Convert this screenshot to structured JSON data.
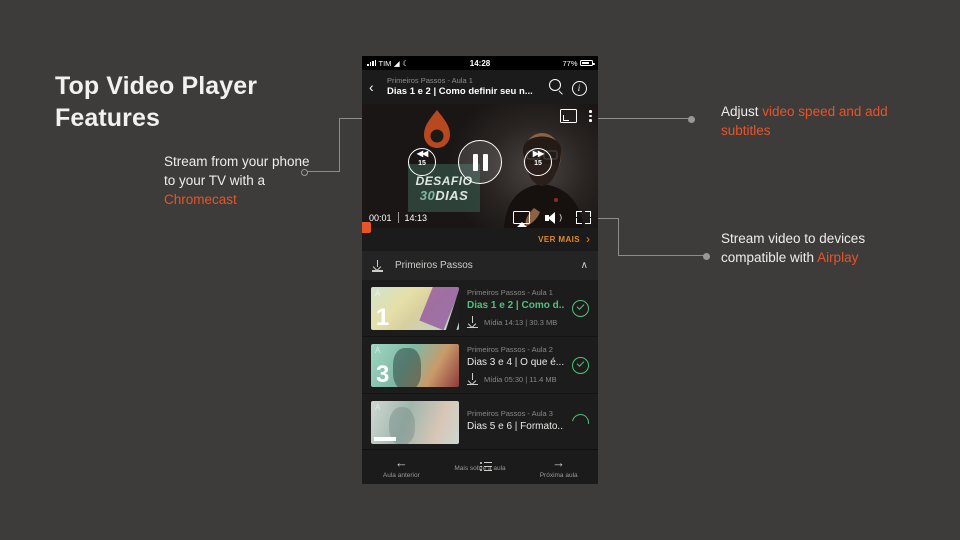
{
  "slide": {
    "title_line1": "Top Video Player",
    "title_line2": "Features",
    "background_color": "#3d3c3a",
    "accent_color": "#e8542a"
  },
  "callouts": {
    "chromecast": {
      "lead": "Stream from your phone to your TV with a ",
      "highlight": "Chromecast"
    },
    "speed": {
      "lead": "Adjust ",
      "highlight": "video speed and add subtitles"
    },
    "airplay": {
      "lead": "Stream video to devices compatible with ",
      "highlight": "Airplay"
    }
  },
  "phone": {
    "status_bar": {
      "carrier": "TIM",
      "time": "14:28",
      "battery_percent": "77%"
    },
    "app_header": {
      "back_icon": "chevron-left-icon",
      "subtitle": "Primeiros Passos - Aula 1",
      "title": "Dias 1 e 2 | Como definir seu n...",
      "search_icon": "search-icon",
      "info_icon": "info-icon"
    },
    "video_player": {
      "cast_icon": "chromecast-icon",
      "more_icon": "kebab-menu-icon",
      "rewind_label": "15",
      "forward_label": "15",
      "play_state_icon": "pause-icon",
      "current_time": "00:01",
      "duration": "14:13",
      "airplay_icon": "airplay-icon",
      "volume_icon": "volume-icon",
      "fullscreen_icon": "fullscreen-icon",
      "overlay_brand_line1": "DESAFIO",
      "overlay_brand_num": "30",
      "overlay_brand_line2": "DIAS"
    },
    "ver_mais": {
      "label": "VER MAIS",
      "chevron": "›"
    },
    "section": {
      "download_icon": "download-icon",
      "name": "Primeiros Passos",
      "collapse_chevron": "∧"
    },
    "lessons": [
      {
        "thumb_label": "1",
        "thumb_tag": "A",
        "supertitle": "Primeiros Passos - Aula 1",
        "title": "Dias 1 e 2 | Como d...",
        "active": true,
        "media_info": "Mídia 14:13 | 30.3 MB",
        "status_icon": "check-circle-icon"
      },
      {
        "thumb_label": "3",
        "thumb_tag": "A",
        "supertitle": "Primeiros Passos - Aula 2",
        "title": "Dias 3 e 4 | O que é...",
        "active": false,
        "media_info": "Mídia 05:30 | 11.4 MB",
        "status_icon": "check-circle-icon"
      },
      {
        "thumb_label": "",
        "thumb_tag": "A",
        "supertitle": "Primeiros Passos - Aula 3",
        "title": "Dias 5 e 6 | Formato...",
        "active": false,
        "media_info": "",
        "status_icon": "progress-circle-icon"
      }
    ],
    "bottom_nav": [
      {
        "icon": "arrow-left-icon",
        "glyph": "←",
        "label": "Aula anterior"
      },
      {
        "icon": "list-icon",
        "glyph": "",
        "label": "Mais sobre a aula"
      },
      {
        "icon": "arrow-right-icon",
        "glyph": "→",
        "label": "Próxima aula"
      }
    ]
  }
}
